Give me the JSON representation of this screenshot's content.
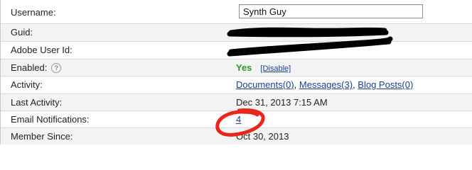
{
  "fields": {
    "username_label": "Username:",
    "username_value": "Synth Guy",
    "guid_label": "Guid:",
    "adobe_id_label": "Adobe User Id:",
    "enabled_label": "Enabled:",
    "enabled_value": "Yes",
    "disable_link": "[Disable]",
    "activity_label": "Activity:",
    "documents_link": "Documents(0)",
    "messages_link": "Messages(3)",
    "blog_posts_link": "Blog Posts(0)",
    "sep1": ",",
    "sep2": ",",
    "last_activity_label": "Last Activity:",
    "last_activity_value": "Dec 31, 2013 7:15 AM",
    "email_notifications_label": "Email Notifications:",
    "email_notifications_value": "4",
    "member_since_label": "Member Since:",
    "member_since_value": "Oct 30, 2013"
  },
  "icons": {
    "help": "?"
  },
  "colors": {
    "enabled_green": "#2a9a1e",
    "link_blue": "#1a3e8c",
    "annotation_red": "#e8261c",
    "row_shade": "#f3f3f3"
  }
}
